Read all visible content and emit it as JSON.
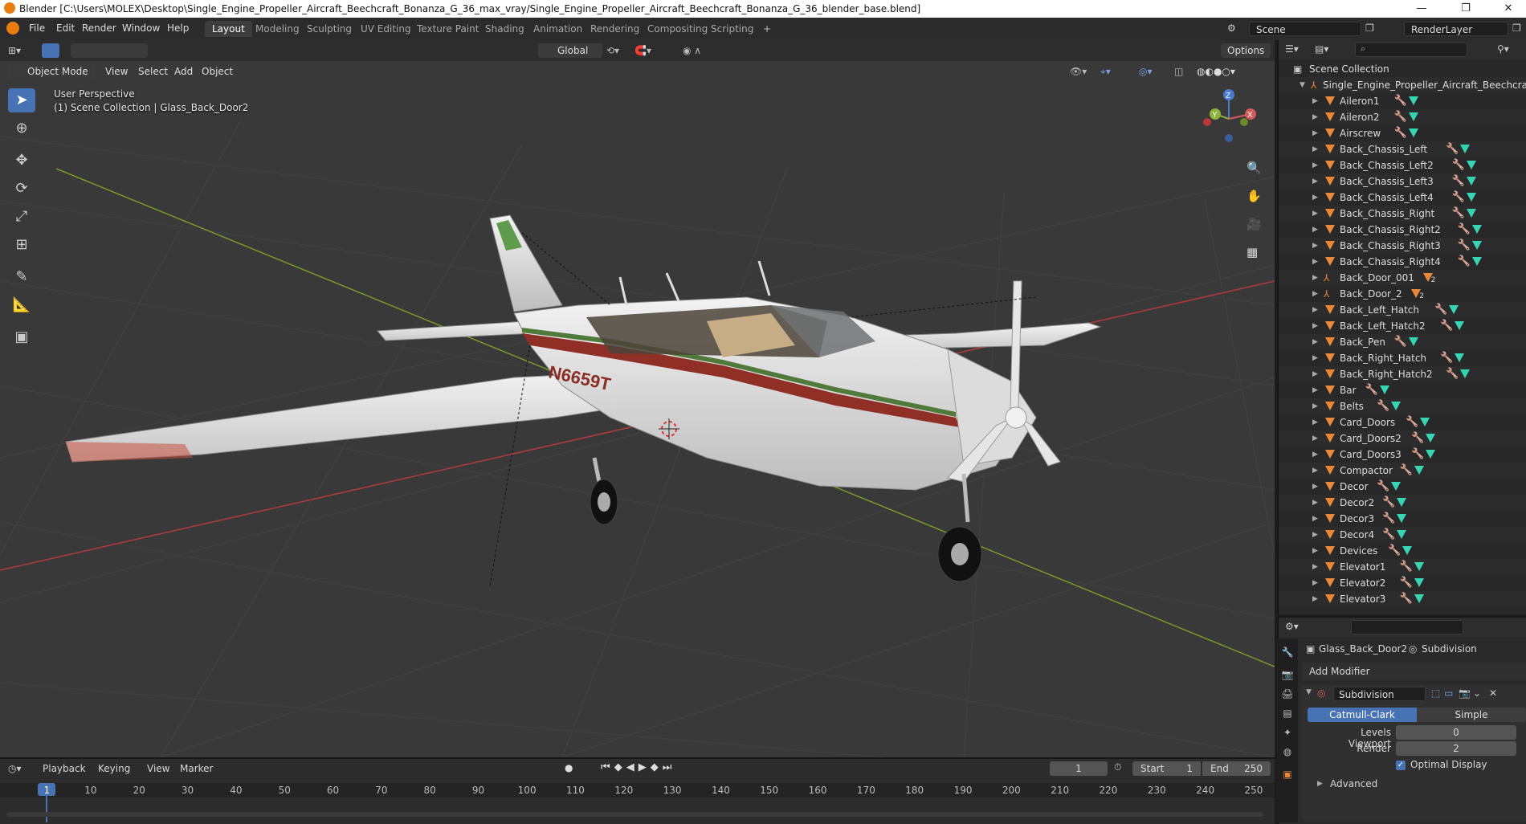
{
  "window": {
    "title": "Blender [C:\\Users\\MOLEX\\Desktop\\Single_Engine_Propeller_Aircraft_Beechcraft_Bonanza_G_36_max_vray/Single_Engine_Propeller_Aircraft_Beechcraft_Bonanza_G_36_blender_base.blend]",
    "minimize": "—",
    "maximize": "❐",
    "close": "✕"
  },
  "menu": {
    "items": [
      "File",
      "Edit",
      "Render",
      "Window",
      "Help"
    ],
    "workspaces": [
      "Layout",
      "Modeling",
      "Sculpting",
      "UV Editing",
      "Texture Paint",
      "Shading",
      "Animation",
      "Rendering",
      "Compositing",
      "Scripting"
    ],
    "active_workspace": "Layout",
    "add_workspace": "+",
    "scene": "Scene",
    "render_layer": "RenderLayer"
  },
  "viewport_header": {
    "mode": "Object Mode",
    "menus": [
      "View",
      "Select",
      "Add",
      "Object"
    ],
    "orientation": "Global",
    "options": "Options"
  },
  "viewport": {
    "perspective": "User Perspective",
    "collection_info": "(1) Scene Collection | Glass_Back_Door2",
    "tail_number": "N6659T",
    "gizmo": {
      "z": "Z",
      "y": "Y",
      "x": "X"
    }
  },
  "outliner": {
    "root": "Scene Collection",
    "collection": "Single_Engine_Propeller_Aircraft_Beechcraft",
    "items": [
      {
        "name": "Aileron1",
        "kind": "mesh"
      },
      {
        "name": "Aileron2",
        "kind": "mesh"
      },
      {
        "name": "Airscrew",
        "kind": "mesh"
      },
      {
        "name": "Back_Chassis_Left",
        "kind": "mesh"
      },
      {
        "name": "Back_Chassis_Left2",
        "kind": "mesh"
      },
      {
        "name": "Back_Chassis_Left3",
        "kind": "mesh"
      },
      {
        "name": "Back_Chassis_Left4",
        "kind": "mesh"
      },
      {
        "name": "Back_Chassis_Right",
        "kind": "mesh"
      },
      {
        "name": "Back_Chassis_Right2",
        "kind": "mesh"
      },
      {
        "name": "Back_Chassis_Right3",
        "kind": "mesh"
      },
      {
        "name": "Back_Chassis_Right4",
        "kind": "mesh"
      },
      {
        "name": "Back_Door_001",
        "kind": "empty",
        "badge": "2"
      },
      {
        "name": "Back_Door_2",
        "kind": "empty",
        "badge": "2"
      },
      {
        "name": "Back_Left_Hatch",
        "kind": "mesh"
      },
      {
        "name": "Back_Left_Hatch2",
        "kind": "mesh"
      },
      {
        "name": "Back_Pen",
        "kind": "mesh"
      },
      {
        "name": "Back_Right_Hatch",
        "kind": "mesh"
      },
      {
        "name": "Back_Right_Hatch2",
        "kind": "mesh"
      },
      {
        "name": "Bar",
        "kind": "mesh"
      },
      {
        "name": "Belts",
        "kind": "mesh"
      },
      {
        "name": "Card_Doors",
        "kind": "mesh"
      },
      {
        "name": "Card_Doors2",
        "kind": "mesh"
      },
      {
        "name": "Card_Doors3",
        "kind": "mesh"
      },
      {
        "name": "Compactor",
        "kind": "mesh"
      },
      {
        "name": "Decor",
        "kind": "mesh"
      },
      {
        "name": "Decor2",
        "kind": "mesh"
      },
      {
        "name": "Decor3",
        "kind": "mesh"
      },
      {
        "name": "Decor4",
        "kind": "mesh"
      },
      {
        "name": "Devices",
        "kind": "mesh"
      },
      {
        "name": "Elevator1",
        "kind": "mesh"
      },
      {
        "name": "Elevator2",
        "kind": "mesh"
      },
      {
        "name": "Elevator3",
        "kind": "mesh"
      }
    ]
  },
  "properties": {
    "object": "Glass_Back_Door2",
    "modifier_tab": "Subdivision",
    "add_modifier": "Add Modifier",
    "modifier_name": "Subdivision",
    "type_options": [
      "Catmull-Clark",
      "Simple"
    ],
    "active_type": "Catmull-Clark",
    "levels_viewport_label": "Levels Viewport",
    "levels_viewport": "0",
    "render_label": "Render",
    "render_value": "2",
    "optimal_display": "Optimal Display",
    "advanced": "Advanced"
  },
  "timeline": {
    "menus": [
      "Playback",
      "Keying",
      "View",
      "Marker"
    ],
    "current_frame": "1",
    "start_label": "Start",
    "start": "1",
    "end_label": "End",
    "end": "250",
    "ticks": [
      "1",
      "10",
      "20",
      "30",
      "40",
      "50",
      "60",
      "70",
      "80",
      "90",
      "100",
      "110",
      "120",
      "130",
      "140",
      "150",
      "160",
      "170",
      "180",
      "190",
      "200",
      "210",
      "220",
      "230",
      "240",
      "250"
    ]
  },
  "colors": {
    "accent": "#4772b3",
    "object_icon": "#e9883a",
    "mesh_icon": "#37d5b4",
    "x_axis": "#b23b3b",
    "y_axis": "#7a9a2a"
  }
}
